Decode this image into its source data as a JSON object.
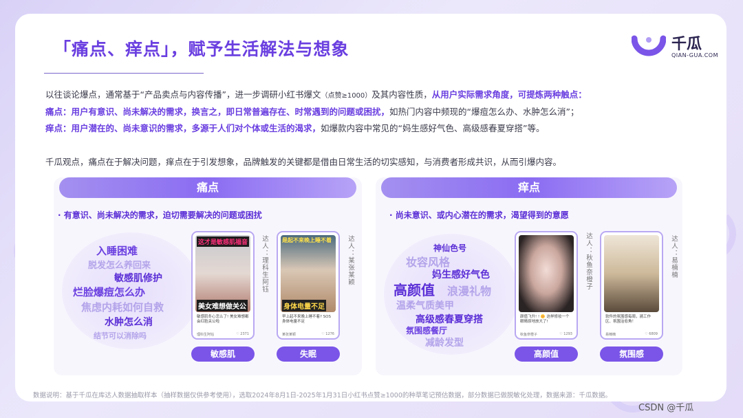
{
  "header": {
    "title": "「痛点、痒点」，赋予生活解法与想象",
    "logo": {
      "name": "千瓜",
      "domain": "QIAN-GUA.COM"
    }
  },
  "intro": {
    "line1_a": "以往谈论爆点，通常基于“产品卖点与内容传播”，进一步调研小红书爆文",
    "line1_small": "（点赞≥1000）",
    "line1_b": "及其内容性质，",
    "line1_hl": "从用户实际需求角度，可提炼两种触点：",
    "line2_hl": "痛点：用户有意识、尚未解决的需求，换言之，即日常普遍存在、时常遇到的问题或困扰，",
    "line2_b": "如热门内容中频现的“爆痘怎么办、水肿怎么消”；",
    "line3_hl": "痒点：用户潜在的、尚未意识的需求，多源于人们对个体或生活的渴求，",
    "line3_b": "如爆款内容中常见的“妈生感好气色、高级感春夏穿搭”等。",
    "line4": "千瓜观点，痛点在于解决问题，痒点在于引发想象，品牌触发的关键都是借由日常生活的切实感知，与消费者形成共识，从而引爆内容。"
  },
  "pain": {
    "heading": "痛点",
    "subtitle": "· 有意识、尚未解决的需求，迫切需要解决的问题或困扰",
    "words": [
      "入睡困难",
      "脱发怎么养回来",
      "敏感肌修护",
      "烂脸爆痘怎么办",
      "焦虑内耗如何自救",
      "水肿怎么消",
      "结节可以消除吗"
    ],
    "cards": [
      {
        "tag": "敏感肌",
        "creator": "达人：理科生阿钰",
        "img_top": "这才是敏感肌福音",
        "img_bottom": "美女难想做关公",
        "caption": "敏感肌冬心怎么了! 美女难想都会红脸关公啦",
        "user": "理科生阿钰",
        "likes": "2371"
      },
      {
        "tag": "失眠",
        "creator": "达人：某张某颖",
        "img_top": "是起不来晚上睡不着",
        "img_bottom": "身体电量不足",
        "caption": "早上起不来晚上睡不着? SOS身体电量不足",
        "user": "某张某颖",
        "likes": "1276"
      }
    ]
  },
  "itch": {
    "heading": "痒点",
    "subtitle": "· 尚未意识、或内心潜在的需求，渴望得到的意愿",
    "words": [
      "神仙色号",
      "妆容风格",
      "妈生感好气色",
      "高颜值",
      "浪漫礼物",
      "温柔气质美甲",
      "高级感春夏穿搭",
      "氛围感餐厅",
      "减龄发型"
    ],
    "cards": [
      {
        "tag": "高颜值",
        "creator": "达人：秋鱼奈橙子",
        "caption": "颜值飞升! ! 🌼 这样修妆一个眼睛原地放大了!",
        "user": "秋鱼奈橙子",
        "likes": "1293"
      },
      {
        "tag": "氛围感",
        "creator": "达人：易楠楠",
        "caption": "软件的氛围感每周，骑工作区、氛围治愈角！",
        "user": "易楠楠",
        "likes": "6809"
      }
    ]
  },
  "footer": {
    "note": "数据说明：基于千瓜在库达人数据抽取样本（抽样数据仅供参考使用），选取2024年8月1日-2025年1月31日小红书点赞≥1000的种草笔记预估数据，部分数据已做脱敏化处理，数据来源：千瓜数据。",
    "watermark": "CSDN @千瓜"
  },
  "colors": {
    "accent": "#6a3fe0",
    "band": "#8a6cf2",
    "tag": "#7a55e8"
  }
}
